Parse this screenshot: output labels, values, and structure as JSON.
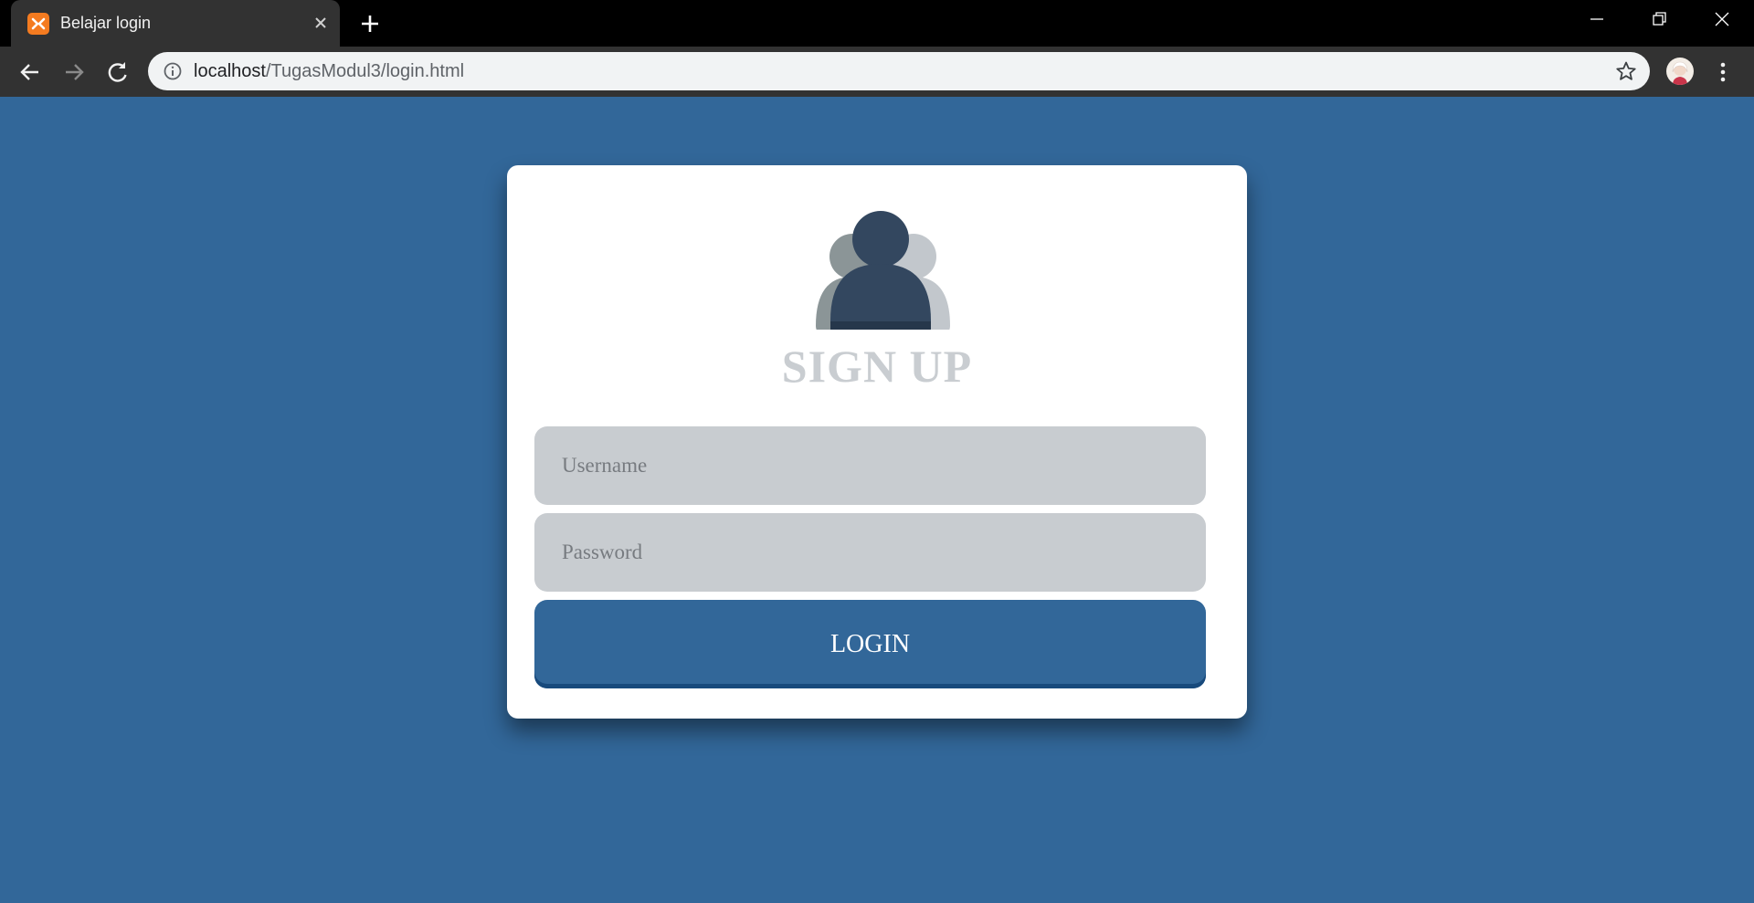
{
  "browser": {
    "tab": {
      "title": "Belajar login",
      "favicon": "xampp-icon"
    },
    "omnibox": {
      "host": "localhost",
      "path": "/TugasModul3/login.html"
    },
    "icons": {
      "back": "arrow-left-icon",
      "forward": "arrow-right-icon",
      "reload": "reload-icon",
      "info": "info-icon",
      "bookmark": "star-icon",
      "menu": "kebab-menu-icon"
    }
  },
  "page": {
    "title": "SIGN UP",
    "username_placeholder": "Username",
    "password_placeholder": "Password",
    "login_label": "LOGIN"
  },
  "colors": {
    "page_background": "#326799",
    "card_background": "#ffffff",
    "title": "#c9cdd1",
    "field_background": "#c8ccd0",
    "button": "#326799",
    "button_edge": "#184a7c",
    "icon_front": "#33475f",
    "icon_left": "#8b9597",
    "icon_right": "#c2c7cc"
  }
}
